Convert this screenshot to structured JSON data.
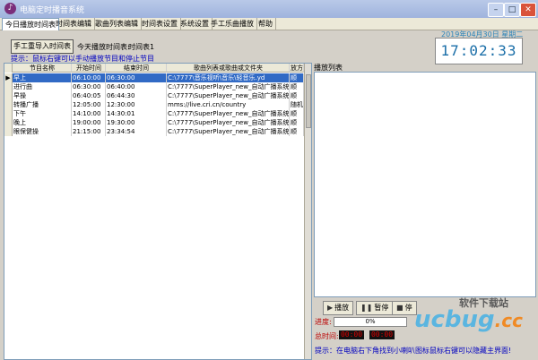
{
  "window": {
    "title": "电脑定时播音系统",
    "app_icon": "music-note-icon"
  },
  "tabs": [
    "今日播放时间表",
    "时间表编辑",
    "歌曲列表编辑",
    "时间表设置",
    "系统设置",
    "手工乐曲播放",
    "帮助"
  ],
  "toolbar": {
    "manual_import_label": "手工重导入时间表",
    "today_label": "今天播放时间表:",
    "plan_label": "时间表1"
  },
  "hint": "提示：鼠标右键可以手动播放节目和停止节目",
  "date": "2019年04月30日 星期二",
  "clock": "17:02:33",
  "table": {
    "headers": [
      "节目名称",
      "开始时间",
      "结束时间",
      "歌曲列表或歌曲或文件夹",
      "放方"
    ],
    "rows": [
      [
        "早上",
        "06:10:00",
        "06:30:00",
        "C:\\7777\\音乐视听\\音乐\\轻音乐.yd",
        "顺"
      ],
      [
        "进行曲",
        "06:30:00",
        "06:40:00",
        "C:\\7777\\SuperPlayer_new_自动广播系统\\w",
        "顺"
      ],
      [
        "早操",
        "06:40:05",
        "06:44:30",
        "C:\\7777\\SuperPlayer_new_自动广播系统\\w",
        "顺"
      ],
      [
        "转播广播",
        "12:05:00",
        "12:30:00",
        "mms://live.cri.cn/country",
        "随机"
      ],
      [
        "下午",
        "14:10:00",
        "14:30:01",
        "C:\\7777\\SuperPlayer_new_自动广播系统\\w",
        "顺"
      ],
      [
        "晚上",
        "19:00:00",
        "19:30:00",
        "C:\\7777\\SuperPlayer_new_自动广播系统\\w",
        "顺"
      ],
      [
        "眼保健操",
        "21:15:00",
        "23:34:54",
        "C:\\7777\\SuperPlayer_new_自动广播系统\\w",
        "顺"
      ]
    ]
  },
  "playlist": {
    "label": "播放列表"
  },
  "controls": {
    "play_label": "播放",
    "pause_label": "暂停",
    "stop_label": "停"
  },
  "progress": {
    "label": "进度:",
    "value_text": "0%",
    "value": 0
  },
  "time": {
    "label": "总时间:",
    "elapsed": "00:00",
    "total": "00:00"
  },
  "footer_hint": "提示：在电脑右下角找到小喇叭图标鼠标右键可以隐藏主界面!",
  "brand": {
    "top": "软件下载站",
    "main": "ucbug",
    "cc": ".cc"
  }
}
